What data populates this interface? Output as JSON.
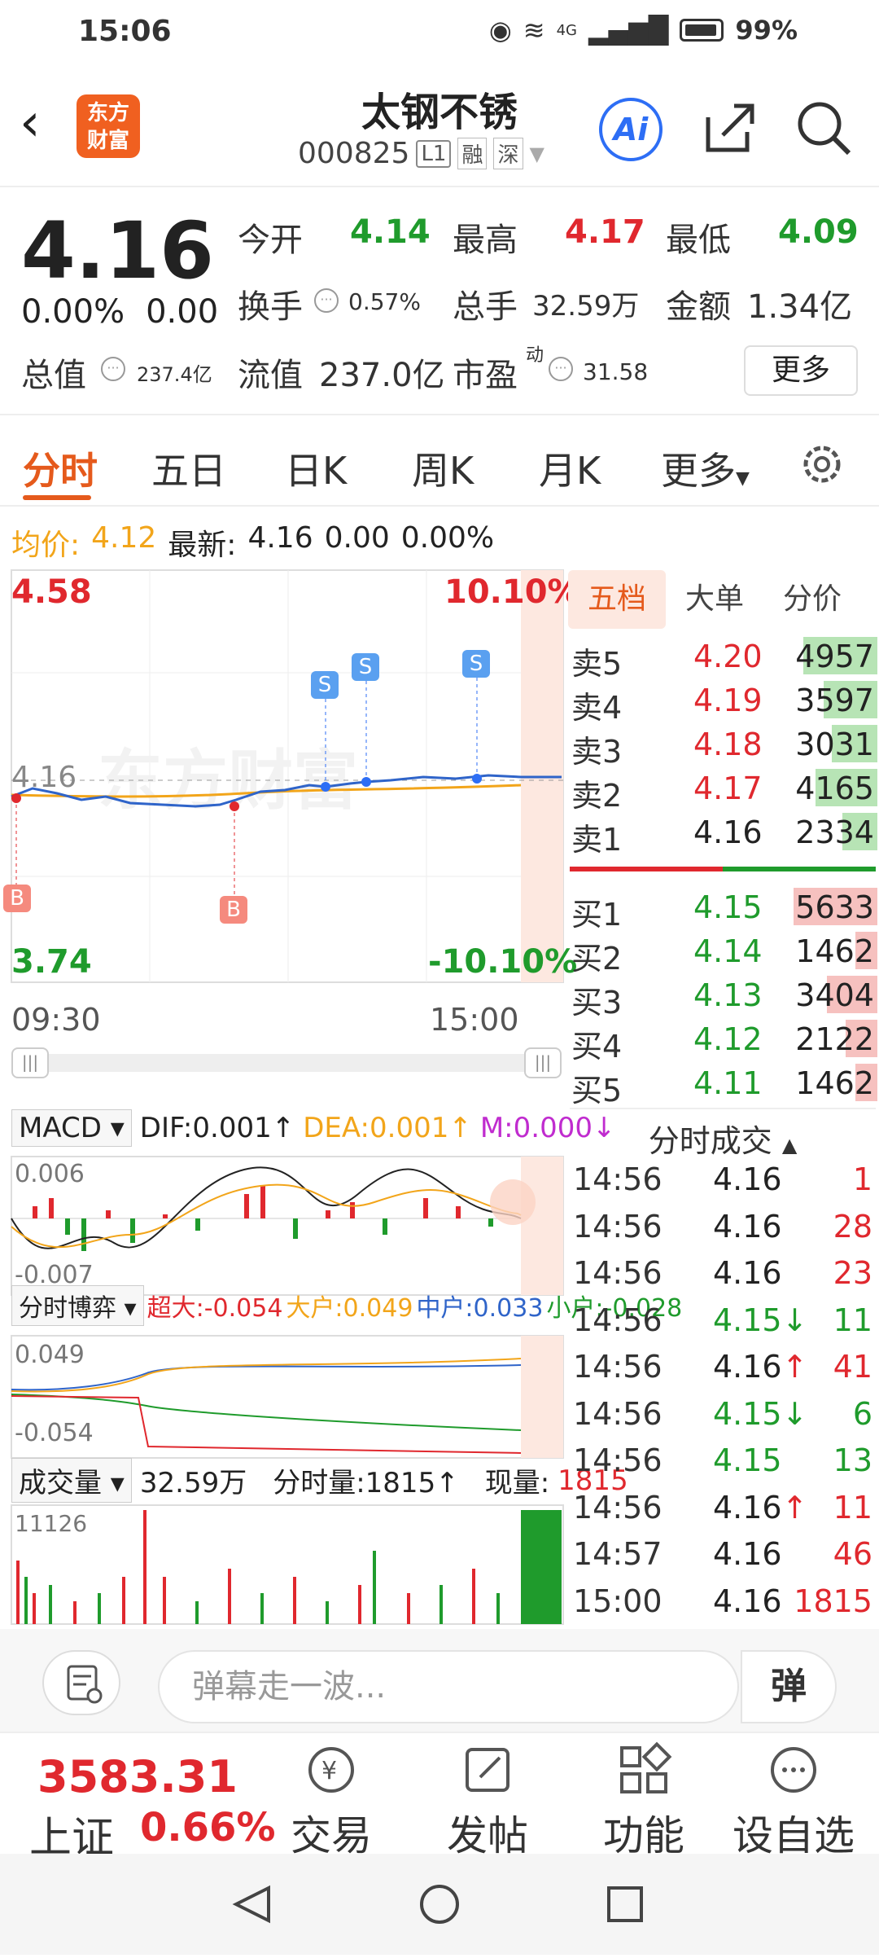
{
  "status": {
    "time": "15:06",
    "network": "4G",
    "battery": "99%"
  },
  "header": {
    "title": "太钢不锈",
    "code": "000825",
    "level": "L1",
    "tag1": "融",
    "tag2": "深",
    "logo_top": "东方",
    "logo_bottom": "财富",
    "ai_label": "Ai"
  },
  "quote": {
    "price": "4.16",
    "change_pct": "0.00%",
    "change": "0.00",
    "open_label": "今开",
    "open": "4.14",
    "high_label": "最高",
    "high": "4.17",
    "low_label": "最低",
    "low": "4.09",
    "turnover_label": "换手",
    "turnover": "0.57%",
    "volume_label": "总手",
    "volume": "32.59万",
    "amount_label": "金额",
    "amount": "1.34亿",
    "mktcap_label": "总值",
    "mktcap": "237.4亿",
    "float_label": "流值",
    "float": "237.0亿",
    "pe_label": "市盈",
    "pe_sup": "动",
    "pe": "31.58",
    "more": "更多"
  },
  "tabs": [
    "分时",
    "五日",
    "日K",
    "周K",
    "月K",
    "更多"
  ],
  "avg": {
    "avg_label": "均价:",
    "avg": "4.12",
    "latest_label": "最新:",
    "latest": "4.16",
    "chg": "0.00",
    "pct": "0.00%"
  },
  "chart": {
    "top_price": "4.58",
    "top_pct": "10.10%",
    "bottom_price": "3.74",
    "bottom_pct": "-10.10%",
    "ref_price": "4.16",
    "start_time": "09:30",
    "end_time": "15:00",
    "watermark": "东方财富",
    "buy_marker": "B",
    "sell_marker": "S"
  },
  "macd": {
    "name": "MACD",
    "dif": "DIF:0.001",
    "dea": "DEA:0.001",
    "m": "M:0.000",
    "top": "0.006",
    "bottom": "-0.007"
  },
  "game": {
    "name": "分时博弈",
    "super": "超大:-0.054",
    "big": "大户:0.049",
    "mid": "中户:0.033",
    "small": "小户:-0.028",
    "top": "0.049",
    "bottom": "-0.054"
  },
  "vol": {
    "name": "成交量",
    "total": "32.59万",
    "period": "分时量:1815",
    "now_label": "现量:",
    "now": "1815",
    "top": "11126"
  },
  "book": {
    "tabs": [
      "五档",
      "大单",
      "分价"
    ],
    "asks": [
      {
        "name": "卖5",
        "price": "4.20",
        "vol": "4957"
      },
      {
        "name": "卖4",
        "price": "4.19",
        "vol": "3597"
      },
      {
        "name": "卖3",
        "price": "4.18",
        "vol": "3031"
      },
      {
        "name": "卖2",
        "price": "4.17",
        "vol": "4165"
      },
      {
        "name": "卖1",
        "price": "4.16",
        "vol": "2334"
      }
    ],
    "bids": [
      {
        "name": "买1",
        "price": "4.15",
        "vol": "5633"
      },
      {
        "name": "买2",
        "price": "4.14",
        "vol": "1462"
      },
      {
        "name": "买3",
        "price": "4.13",
        "vol": "3404"
      },
      {
        "name": "买4",
        "price": "4.12",
        "vol": "2122"
      },
      {
        "name": "买5",
        "price": "4.11",
        "vol": "1462"
      }
    ]
  },
  "trades": {
    "title": "分时成交",
    "rows": [
      {
        "time": "14:56",
        "price": "4.16",
        "arrow": "",
        "vol": "1"
      },
      {
        "time": "14:56",
        "price": "4.16",
        "arrow": "",
        "vol": "28"
      },
      {
        "time": "14:56",
        "price": "4.16",
        "arrow": "",
        "vol": "23"
      },
      {
        "time": "14:56",
        "price": "4.15",
        "arrow": "↓",
        "vol": "11"
      },
      {
        "time": "14:56",
        "price": "4.16",
        "arrow": "↑",
        "vol": "41"
      },
      {
        "time": "14:56",
        "price": "4.15",
        "arrow": "↓",
        "vol": "6"
      },
      {
        "time": "14:56",
        "price": "4.15",
        "arrow": "",
        "vol": "13"
      },
      {
        "time": "14:56",
        "price": "4.16",
        "arrow": "↑",
        "vol": "11"
      },
      {
        "time": "14:57",
        "price": "4.16",
        "arrow": "",
        "vol": "46"
      },
      {
        "time": "15:00",
        "price": "4.16",
        "arrow": "",
        "vol": "1815"
      }
    ]
  },
  "comment": {
    "placeholder": "弹幕走一波...",
    "button": "弹"
  },
  "bottom": {
    "index_value": "3583.31",
    "index_name": "上证",
    "index_pct": "0.66%",
    "nav": [
      "交易",
      "发帖",
      "功能",
      "设自选"
    ]
  }
}
